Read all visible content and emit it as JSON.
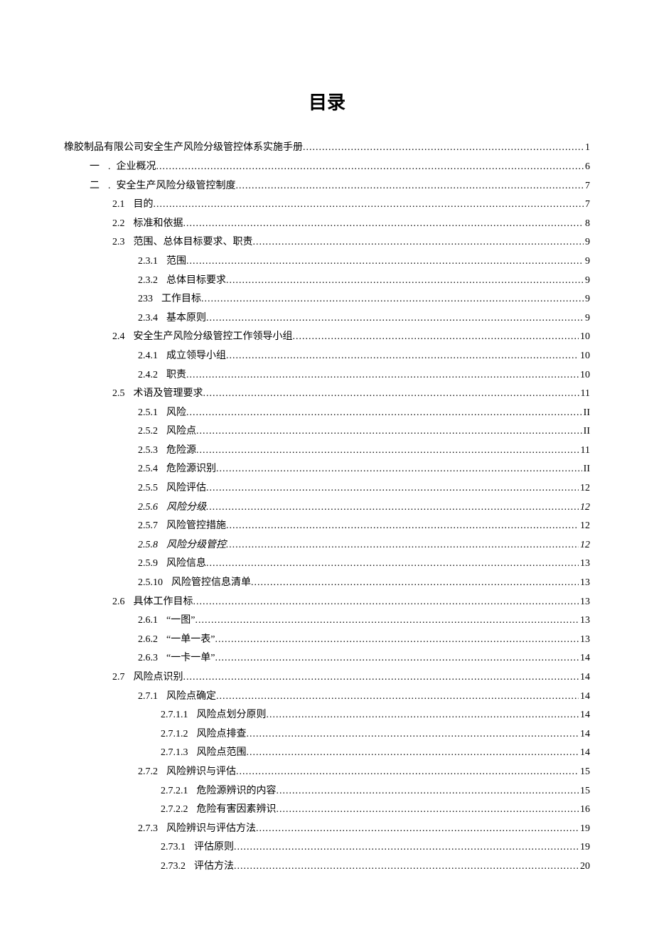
{
  "title": "目录",
  "entries": [
    {
      "level": 0,
      "label": "橡胶制品有限公司安全生产风险分级管控体系实施手册",
      "page": "1"
    },
    {
      "level": 1,
      "num": "一",
      "sep": ".",
      "label": "企业概况",
      "page": "6"
    },
    {
      "level": 1,
      "num": "二",
      "sep": ".",
      "label": "安全生产风险分级管控制度",
      "page": "7"
    },
    {
      "level": 2,
      "num": "2.1",
      "label": "目的",
      "page": "7"
    },
    {
      "level": 2,
      "num": "2.2",
      "label": "标准和依据",
      "page": "8"
    },
    {
      "level": 2,
      "num": "2.3",
      "label": "范围、总体目标要求、职责",
      "page": "9"
    },
    {
      "level": 3,
      "num": "2.3.1",
      "label": "范围",
      "page": "9"
    },
    {
      "level": 3,
      "num": "2.3.2",
      "label": "总体目标要求",
      "page": "9"
    },
    {
      "level": 3,
      "num": "233",
      "label": "工作目标",
      "page": "9"
    },
    {
      "level": 3,
      "num": "2.3.4",
      "label": "基本原则",
      "page": "9"
    },
    {
      "level": 2,
      "num": "2.4",
      "label": "安全生产风险分级管控工作领导小组",
      "page": "10"
    },
    {
      "level": 3,
      "num": "2.4.1",
      "label": "成立领导小组",
      "page": "10"
    },
    {
      "level": 3,
      "num": "2.4.2",
      "label": "职责",
      "page": "10"
    },
    {
      "level": 2,
      "num": "2.5",
      "label": "术语及管理要求",
      "page": "11"
    },
    {
      "level": 3,
      "num": "2.5.1",
      "label": "风险",
      "page": "II"
    },
    {
      "level": 3,
      "num": "2.5.2",
      "label": "风险点",
      "page": "II"
    },
    {
      "level": 3,
      "num": "2.5.3",
      "label": "危险源",
      "page": "11"
    },
    {
      "level": 3,
      "num": "2.5.4",
      "label": "危险源识别",
      "page": "II"
    },
    {
      "level": 3,
      "num": "2.5.5",
      "label": "风险评估",
      "page": "12"
    },
    {
      "level": 3,
      "num": "2.5.6",
      "label": "风险分级",
      "page": "12",
      "italic": true
    },
    {
      "level": 3,
      "num": "2.5.7",
      "label": "风险管控措施",
      "page": "12"
    },
    {
      "level": 3,
      "num": "2.5.8",
      "label": "风险分级管控",
      "page": "12",
      "italic": true
    },
    {
      "level": 3,
      "num": "2.5.9",
      "label": "风险信息",
      "page": "13"
    },
    {
      "level": 3,
      "num": "2.5.10",
      "label": "风险管控信息清单",
      "page": "13"
    },
    {
      "level": 2,
      "num": "2.6",
      "label": "具体工作目标",
      "page": "13"
    },
    {
      "level": 3,
      "num": "2.6.1",
      "label": "“一图”",
      "page": "13"
    },
    {
      "level": 3,
      "num": "2.6.2",
      "label": "“一单一表”",
      "page": "13"
    },
    {
      "level": 3,
      "num": "2.6.3",
      "label": "“一卡一单”",
      "page": "14"
    },
    {
      "level": 2,
      "num": "2.7",
      "label": "风险点识别",
      "page": "14"
    },
    {
      "level": 3,
      "num": "2.7.1",
      "label": "风险点确定",
      "page": "14"
    },
    {
      "level": 4,
      "num": "2.7.1.1",
      "label": "风险点划分原则",
      "page": "14"
    },
    {
      "level": 4,
      "num": "2.7.1.2",
      "label": "风险点排查",
      "page": "14"
    },
    {
      "level": 4,
      "num": "2.7.1.3",
      "label": "风险点范围",
      "page": "14"
    },
    {
      "level": 3,
      "num": "2.7.2",
      "label": "风险辨识与评估",
      "page": "15"
    },
    {
      "level": 4,
      "num": "2.7.2.1",
      "label": "危险源辨识的内容",
      "page": "15"
    },
    {
      "level": 4,
      "num": "2.7.2.2",
      "label": "危险有害因素辨识",
      "page": "16"
    },
    {
      "level": 3,
      "num": "2.7.3",
      "label": "风险辨识与评估方法",
      "page": "19"
    },
    {
      "level": 4,
      "num": "2.73.1",
      "label": "评估原则",
      "page": "19"
    },
    {
      "level": 4,
      "num": "2.73.2",
      "label": "评估方法",
      "page": "20"
    }
  ]
}
